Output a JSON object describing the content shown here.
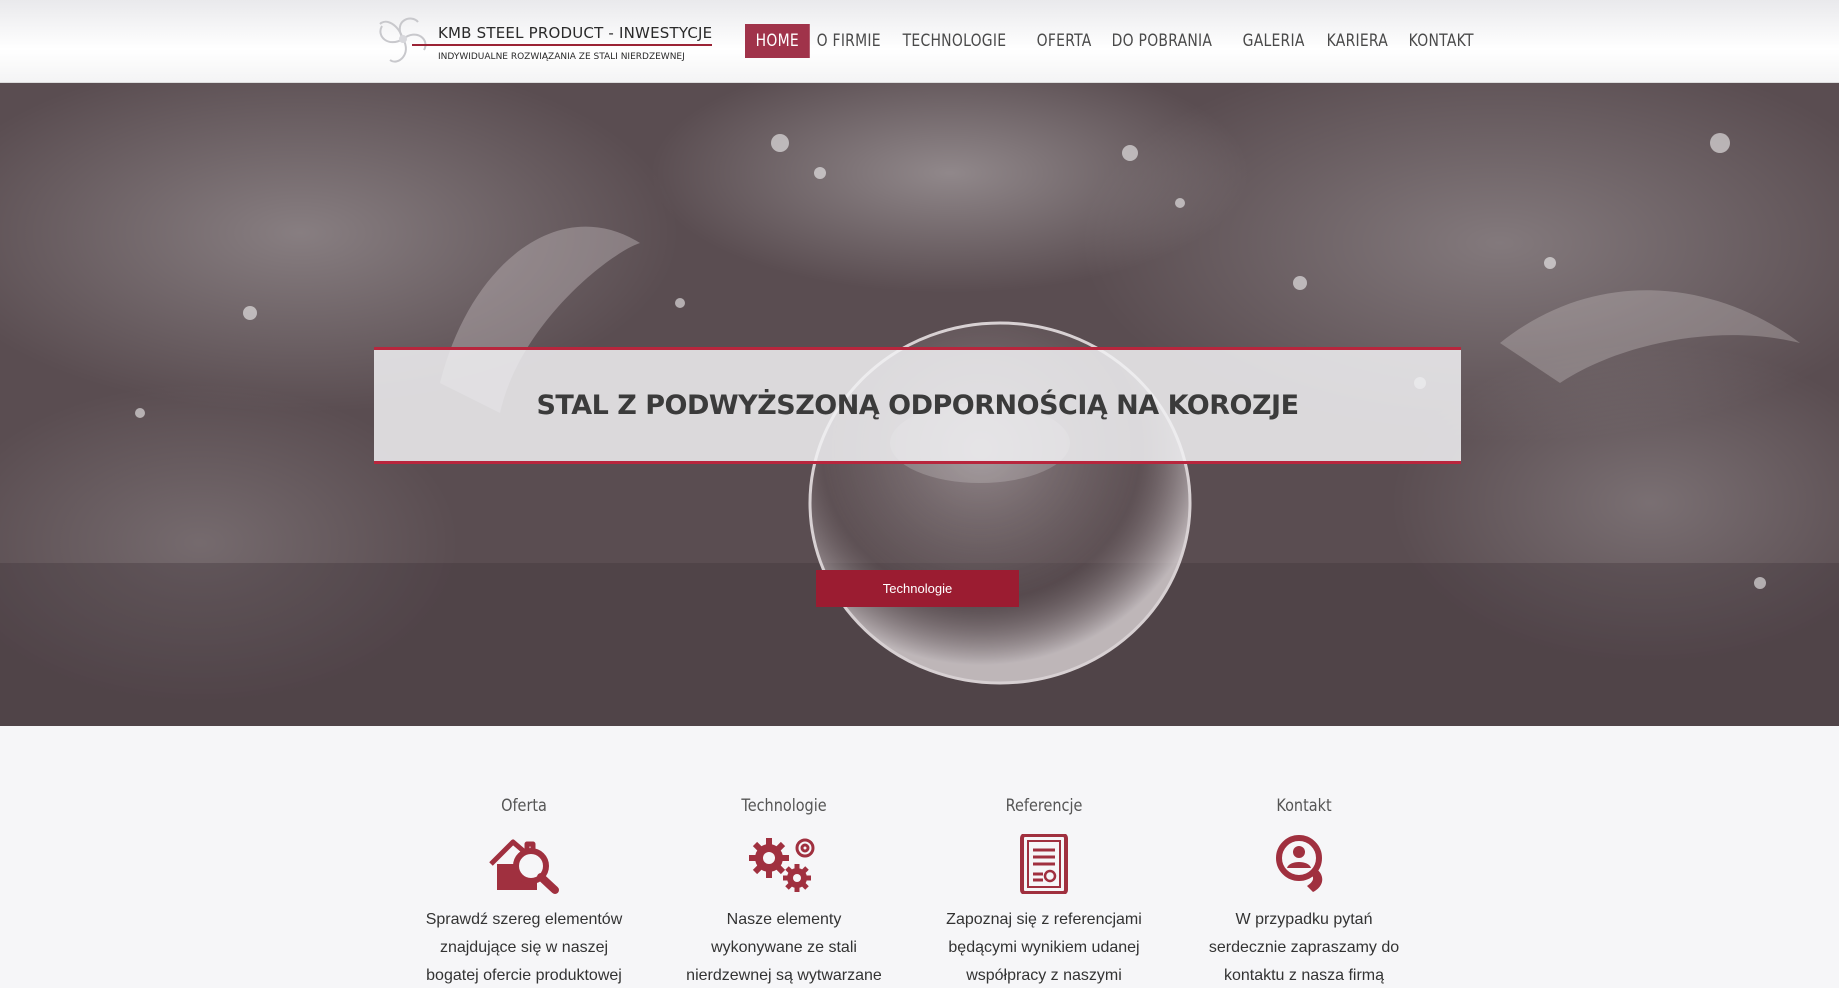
{
  "header": {
    "logo_title": "KMB STEEL PRODUCT - INWESTYCJE",
    "logo_subtitle": "INDYWIDUALNE ROZWIĄZANIA ZE STALI NIERDZEWNEJ",
    "nav": [
      {
        "label": "HOME",
        "active": true
      },
      {
        "label": "O FIRMIE"
      },
      {
        "label": "TECHNOLOGIE"
      },
      {
        "label": "OFERTA"
      },
      {
        "label": "DO POBRANIA"
      },
      {
        "label": "GALERIA"
      },
      {
        "label": "KARIERA"
      },
      {
        "label": "KONTAKT"
      }
    ]
  },
  "hero": {
    "heading": "STAL Z PODWYŻSZONĄ ODPORNOŚCIĄ NA KOROZJE",
    "button_label": "Technologie"
  },
  "features": [
    {
      "title": "Oferta",
      "icon": "house-search-icon",
      "text_lines": [
        "Sprawdź szereg elementów",
        "znajdujące się w naszej",
        "bogatej ofercie produktowej"
      ]
    },
    {
      "title": "Technologie",
      "icon": "gears-icon",
      "text_lines": [
        "Nasze elementy",
        "wykonywane ze stali",
        "nierdzewnej są wytwarzane"
      ]
    },
    {
      "title": "Referencje",
      "icon": "certificate-icon",
      "text_lines": [
        "Zapoznaj się z referencjami",
        "będącymi wynikiem udanej",
        "współpracy z naszymi"
      ]
    },
    {
      "title": "Kontakt",
      "icon": "phone-contact-icon",
      "text_lines": [
        "W przypadku pytań",
        "serdecznie zapraszamy do",
        "kontaktu z nasza firmą"
      ]
    }
  ],
  "colors": {
    "accent": "#9b1c31",
    "nav_active": "#a0334a",
    "banner_border": "#b8263d",
    "icon": "#a0303f"
  }
}
